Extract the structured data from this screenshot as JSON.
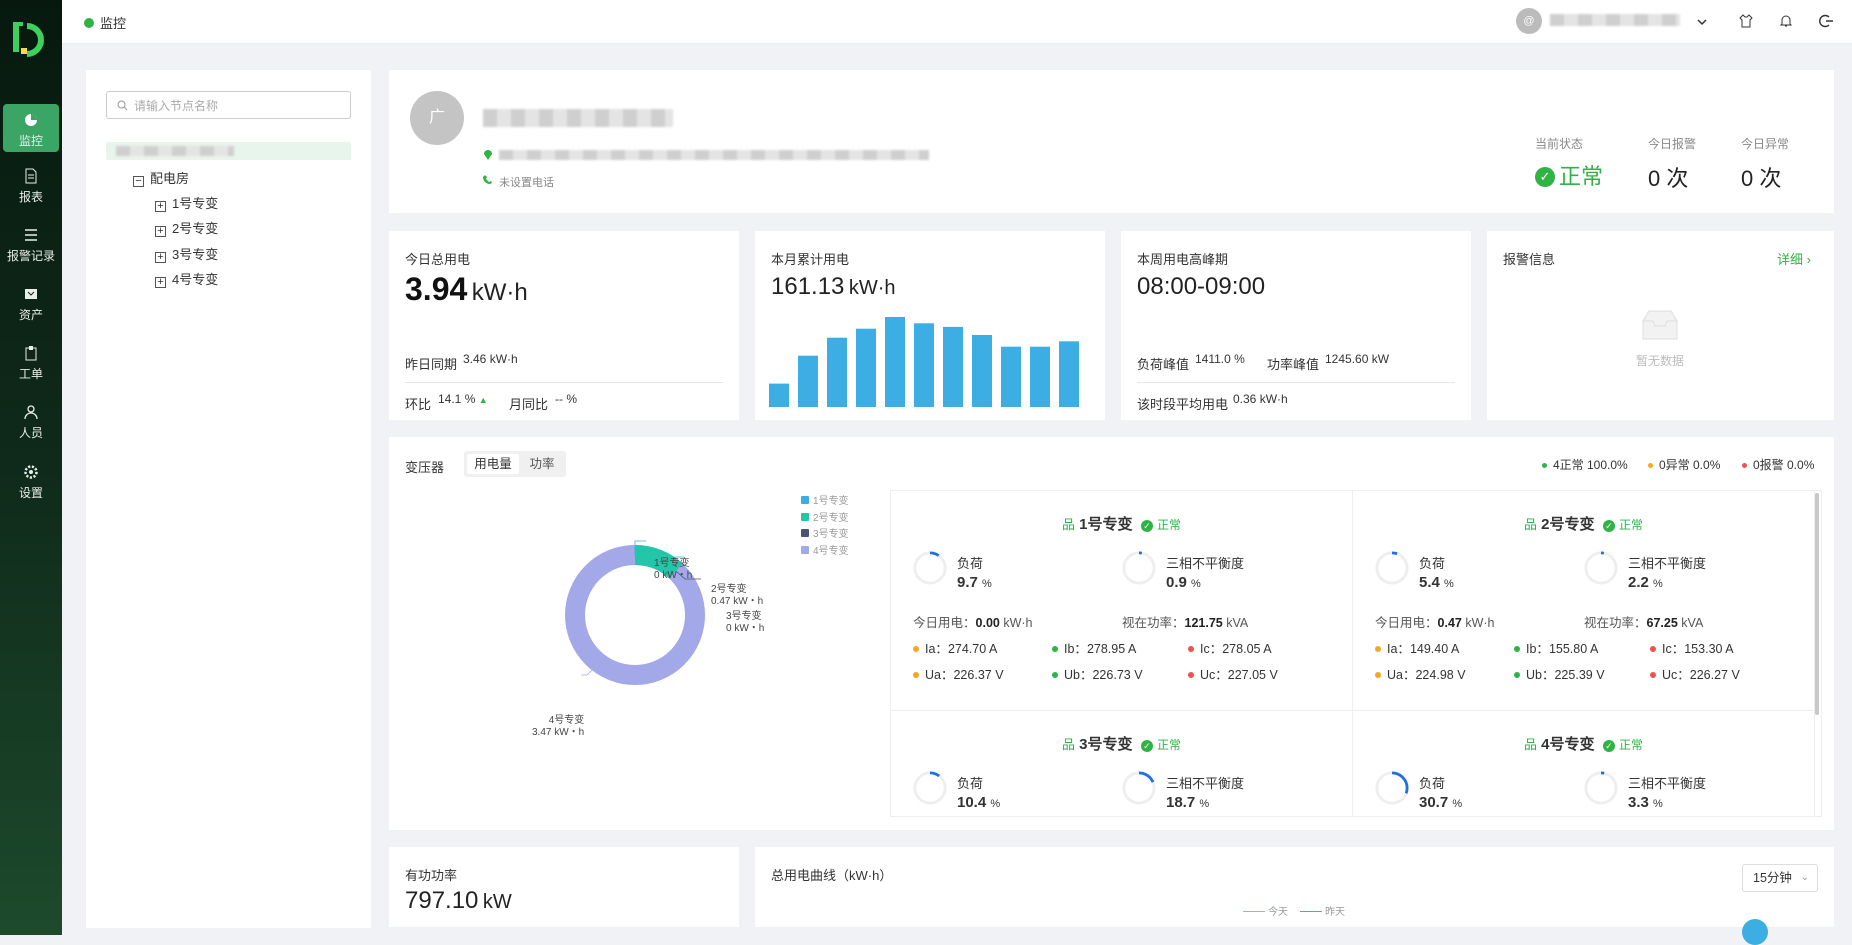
{
  "nav": [
    {
      "label": "监控",
      "icon": "pie-chart-icon",
      "active": true
    },
    {
      "label": "报表",
      "icon": "file-icon"
    },
    {
      "label": "报警记录",
      "icon": "list-icon"
    },
    {
      "label": "资产",
      "icon": "asset-icon"
    },
    {
      "label": "工单",
      "icon": "clipboard-icon"
    },
    {
      "label": "人员",
      "icon": "user-icon"
    },
    {
      "label": "设置",
      "icon": "gear-icon"
    }
  ],
  "header": {
    "title": "监控",
    "avatar": "@"
  },
  "tree": {
    "search_placeholder": "请输入节点名称",
    "room": "配电房",
    "items": [
      "1号专变",
      "2号专变",
      "3号专变",
      "4号专变"
    ]
  },
  "site": {
    "avatar": "广",
    "phone": "未设置电话",
    "status_label": "当前状态",
    "status": "正常",
    "alarm_label": "今日报警",
    "alarm": "0 次",
    "abnormal_label": "今日异常",
    "abnormal": "0 次"
  },
  "today": {
    "label": "今日总用电",
    "value": "3.94",
    "unit": "kW·h",
    "yoy_label": "昨日同期",
    "yoy": "3.46 kW·h",
    "mom_label": "环比",
    "mom": "14.1 %",
    "month_label": "月同比",
    "month": "-- %"
  },
  "month": {
    "label": "本月累计用电",
    "value": "161.13",
    "unit": "kW·h",
    "bars": [
      0.26,
      0.57,
      0.77,
      0.87,
      1.0,
      0.93,
      0.89,
      0.8,
      0.67,
      0.67,
      0.73
    ]
  },
  "peak": {
    "label": "本周用电高峰期",
    "value": "08:00-09:00",
    "load_label": "负荷峰值",
    "load": "1411.0 %",
    "power_label": "功率峰值",
    "power": "1245.60 kW",
    "avg_label": "该时段平均用电",
    "avg": "0.36 kW·h"
  },
  "alarm": {
    "label": "报警信息",
    "detail": "详细",
    "empty": "暂无数据"
  },
  "transformer": {
    "label": "变压器",
    "tabs": [
      "用电量",
      "功率"
    ],
    "summary": [
      "4正常 100.0%",
      "0异常 0.0%",
      "0报警 0.0%"
    ],
    "legend": [
      "1号专变",
      "2号专变",
      "3号专变",
      "4号专变"
    ],
    "donut": [
      {
        "name": "1号专变",
        "value": "0 kW・h"
      },
      {
        "name": "2号专变",
        "value": "0.47 kW・h"
      },
      {
        "name": "3号专变",
        "value": "0 kW・h"
      },
      {
        "name": "4号专变",
        "value": "3.47 kW・h"
      }
    ],
    "units": [
      {
        "name": "1号专变",
        "status": "正常",
        "load": "9.7",
        "imb": "0.9",
        "today": "0.00",
        "apparent": "121.75",
        "Ia": "274.70 A",
        "Ib": "278.95 A",
        "Ic": "278.05 A",
        "Ua": "226.37 V",
        "Ub": "226.73 V",
        "Uc": "227.05 V"
      },
      {
        "name": "2号专变",
        "status": "正常",
        "load": "5.4",
        "imb": "2.2",
        "today": "0.47",
        "apparent": "67.25",
        "Ia": "149.40 A",
        "Ib": "155.80 A",
        "Ic": "153.30 A",
        "Ua": "224.98 V",
        "Ub": "225.39 V",
        "Uc": "226.27 V"
      },
      {
        "name": "3号专变",
        "status": "正常",
        "load": "10.4",
        "imb": "18.7"
      },
      {
        "name": "4号专变",
        "status": "正常",
        "load": "30.7",
        "imb": "3.3"
      }
    ],
    "labels": {
      "load": "负荷",
      "imb": "三相不平衡度",
      "today": "今日用电：",
      "apparent": "视在功率：",
      "kwh": "kW·h",
      "kva": "kVA",
      "pct": "%",
      "ia": "Ia：",
      "ib": "Ib：",
      "ic": "Ic：",
      "ua": "Ua：",
      "ub": "Ub：",
      "uc": "Uc："
    }
  },
  "power": {
    "label": "有功功率",
    "value": "797.10",
    "unit": "kW"
  },
  "curve": {
    "label": "总用电曲线（kW·h）",
    "interval": "15分钟",
    "legend_today": "今天",
    "legend_yesterday": "昨天"
  },
  "colors": {
    "accent": "#2fb344",
    "bar": "#3daee3",
    "donut4": "#a3a8e8",
    "donut2": "#23c6a8"
  }
}
